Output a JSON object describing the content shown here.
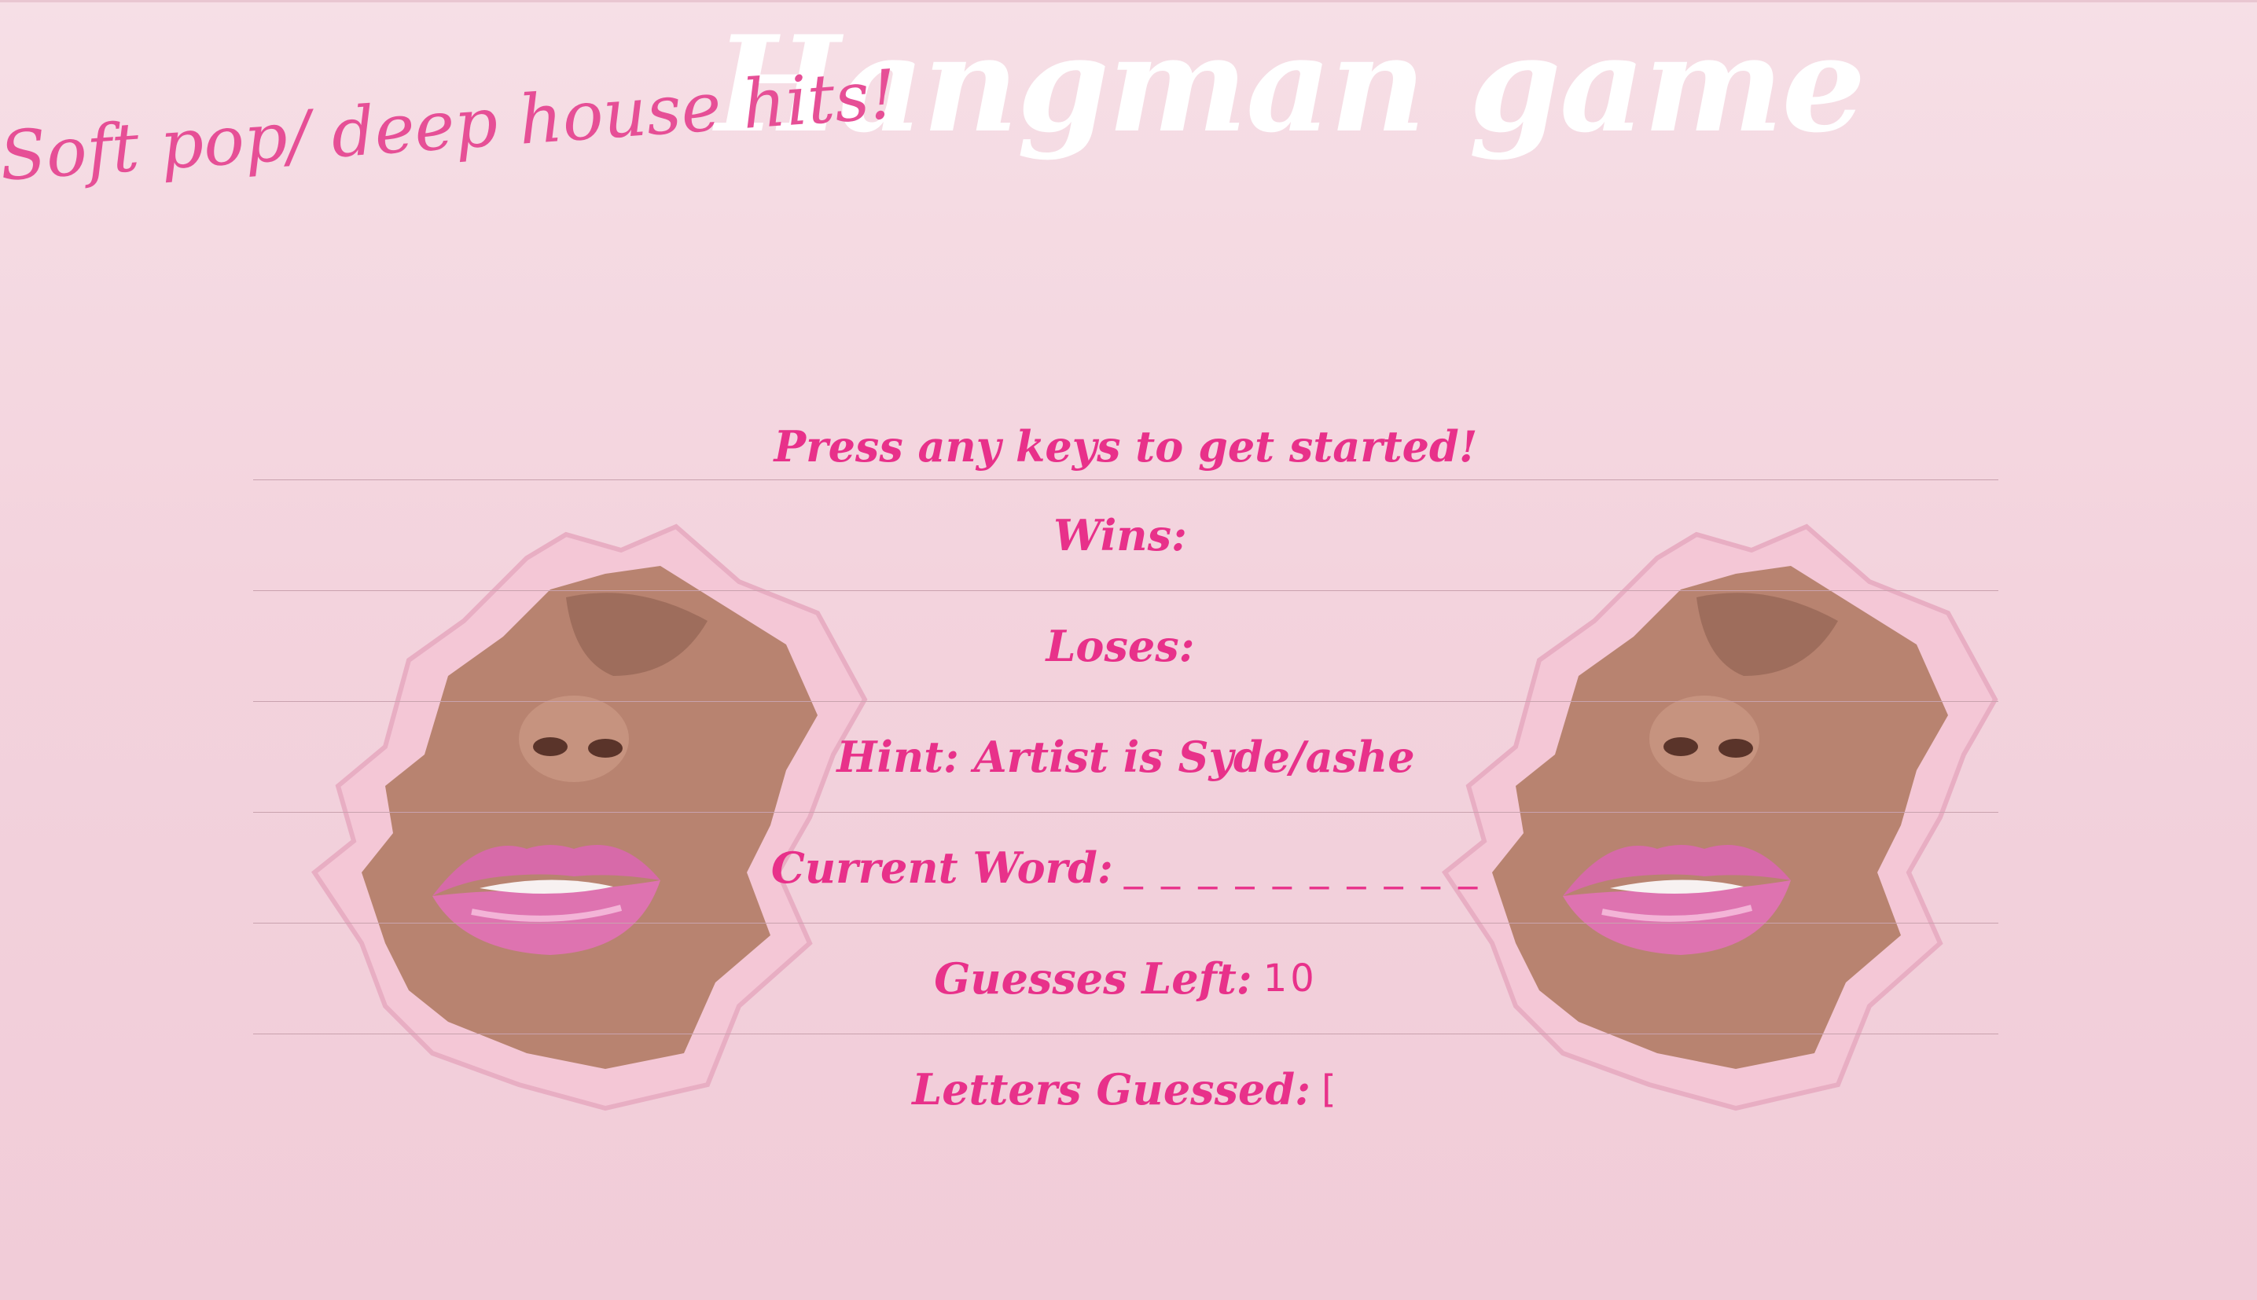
{
  "header": {
    "title": "Hangman game",
    "subtitle": "Soft pop/ deep house hits!"
  },
  "game": {
    "start_prompt": "Press any keys to get started!",
    "wins_label": "Wins:",
    "wins_value": "",
    "loses_label": "Loses:",
    "loses_value": "",
    "hint": "Hint: Artist is Syde/ashe",
    "current_word_label": "Current Word:",
    "current_word_value": "_ _ _ _ _ _ _ _ _ _",
    "guesses_left_label": "Guesses Left:",
    "guesses_left_value": "10",
    "letters_guessed_label": "Letters Guessed:",
    "letters_guessed_value": "["
  },
  "colors": {
    "background": "#f3d3dd",
    "accent_pink": "#e8318a",
    "subtitle_pink": "#e64f96",
    "title_white": "#ffffff",
    "lips": "#d85fa6"
  },
  "images": {
    "left_illustration": "torn-paper-lips-image",
    "right_illustration": "torn-paper-lips-image"
  }
}
